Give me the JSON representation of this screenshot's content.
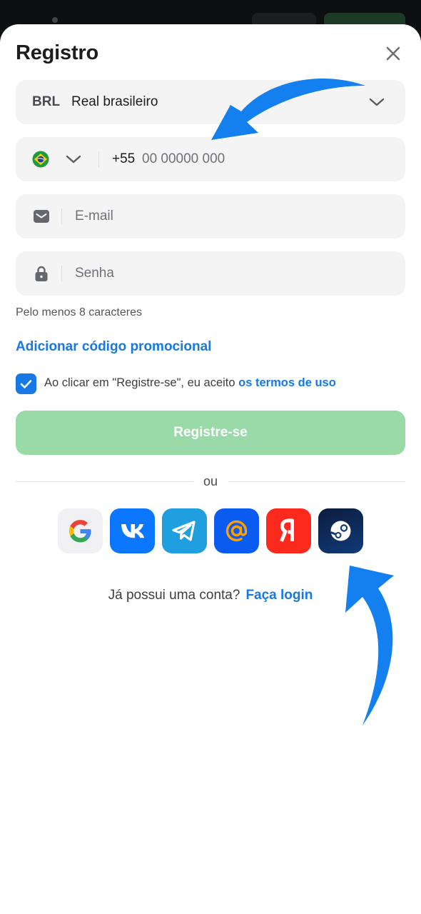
{
  "modal": {
    "title": "Registro"
  },
  "currency": {
    "code": "BRL",
    "name": "Real brasileiro"
  },
  "phone": {
    "prefix": "+55",
    "placeholder": "00 00000 000"
  },
  "email": {
    "placeholder": "E-mail"
  },
  "password": {
    "placeholder": "Senha",
    "hint": "Pelo menos 8 caracteres"
  },
  "promo_link": "Adicionar código promocional",
  "terms": {
    "checked": true,
    "text": "Ao clicar em \"Registre-se\", eu aceito",
    "link": "os termos de uso"
  },
  "submit_label": "Registre-se",
  "divider_text": "ou",
  "social_buttons": [
    {
      "icon": "google-icon",
      "color": "#f1f1f3"
    },
    {
      "icon": "vk-icon",
      "color": "#0b77ff"
    },
    {
      "icon": "telegram-icon",
      "color": "#1f9fe0"
    },
    {
      "icon": "mailru-icon",
      "color": "#0a5cf0"
    },
    {
      "icon": "yandex-icon",
      "color": "#fb2a1c"
    },
    {
      "icon": "steam-icon",
      "color": "#0c2a55"
    }
  ],
  "login": {
    "question": "Já possui uma conta?",
    "link": "Faça login"
  },
  "colors": {
    "accent": "#1778e6",
    "submit_disabled": "#9adaa9",
    "annotation_arrow": "#1480f0"
  }
}
